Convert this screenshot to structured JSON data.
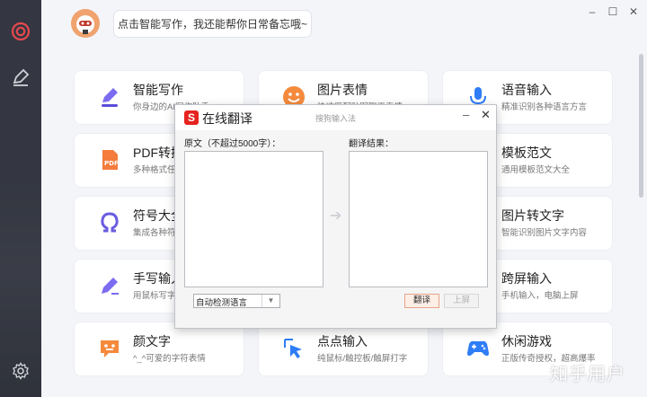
{
  "topbar": {
    "assistant_prompt": "点击智能写作，我还能帮你日常备忘哦~",
    "window_controls": [
      "–",
      "☐",
      "✕"
    ]
  },
  "sidebar": {
    "items": [
      {
        "icon": "target-icon"
      },
      {
        "icon": "pen-icon"
      },
      {
        "icon": "gear-icon"
      }
    ]
  },
  "cards": [
    {
      "title": "智能写作",
      "subtitle": "你身边的AI写作助手",
      "icon": "writing-pen-icon"
    },
    {
      "title": "图片表情",
      "subtitle": "快速匹配贴图聊天表情",
      "icon": "smiley-face-icon"
    },
    {
      "title": "语音输入",
      "subtitle": "精准识别各种语言方言",
      "icon": "microphone-icon"
    },
    {
      "title": "PDF转换",
      "subtitle": "多种格式任意转换",
      "icon": "pdf-file-icon"
    },
    {
      "title": "模板范文",
      "subtitle": "通用模板范文大全",
      "icon": "template-doc-icon"
    },
    {
      "title": "符号大全",
      "subtitle": "集成各种符号",
      "icon": "omega-symbol-icon"
    },
    {
      "title": "图片转文字",
      "subtitle": "智能识别图片文字内容",
      "icon": "image-to-text-icon"
    },
    {
      "title": "手写输入",
      "subtitle": "用鼠标写字",
      "icon": "handwriting-pen-icon"
    },
    {
      "title": "跨屏输入",
      "subtitle": "手机输入，电脑上屏",
      "icon": "cross-screen-icon"
    },
    {
      "title": "颜文字",
      "subtitle": "^_^可爱的字符表情",
      "icon": "emoticon-icon"
    },
    {
      "title": "点点输入",
      "subtitle": "纯鼠标/触控板/触屏打字",
      "icon": "click-cursor-icon"
    },
    {
      "title": "休闲游戏",
      "subtitle": "正版传奇授权，超高爆率",
      "icon": "gamepad-icon"
    }
  ],
  "dialog": {
    "title": "在线翻译",
    "ime_label": "搜狗输入法",
    "source_label": "原文（不超过5000字）：",
    "result_label": "翻译结果：",
    "source_text": "",
    "result_text": "",
    "language_select": "自动检测语言",
    "translate_button": "翻译",
    "to_screen_button": "上屏",
    "minimize": "–",
    "close": "✕",
    "logo_glyph": "S"
  },
  "watermark": "知乎用户",
  "colors": {
    "rail": "#343741",
    "accent_purple": "#6a5ce0",
    "accent_orange": "#f58a3c",
    "accent_red": "#e5231f",
    "accent_blue": "#2f7df6",
    "background": "#f4f5f9"
  }
}
